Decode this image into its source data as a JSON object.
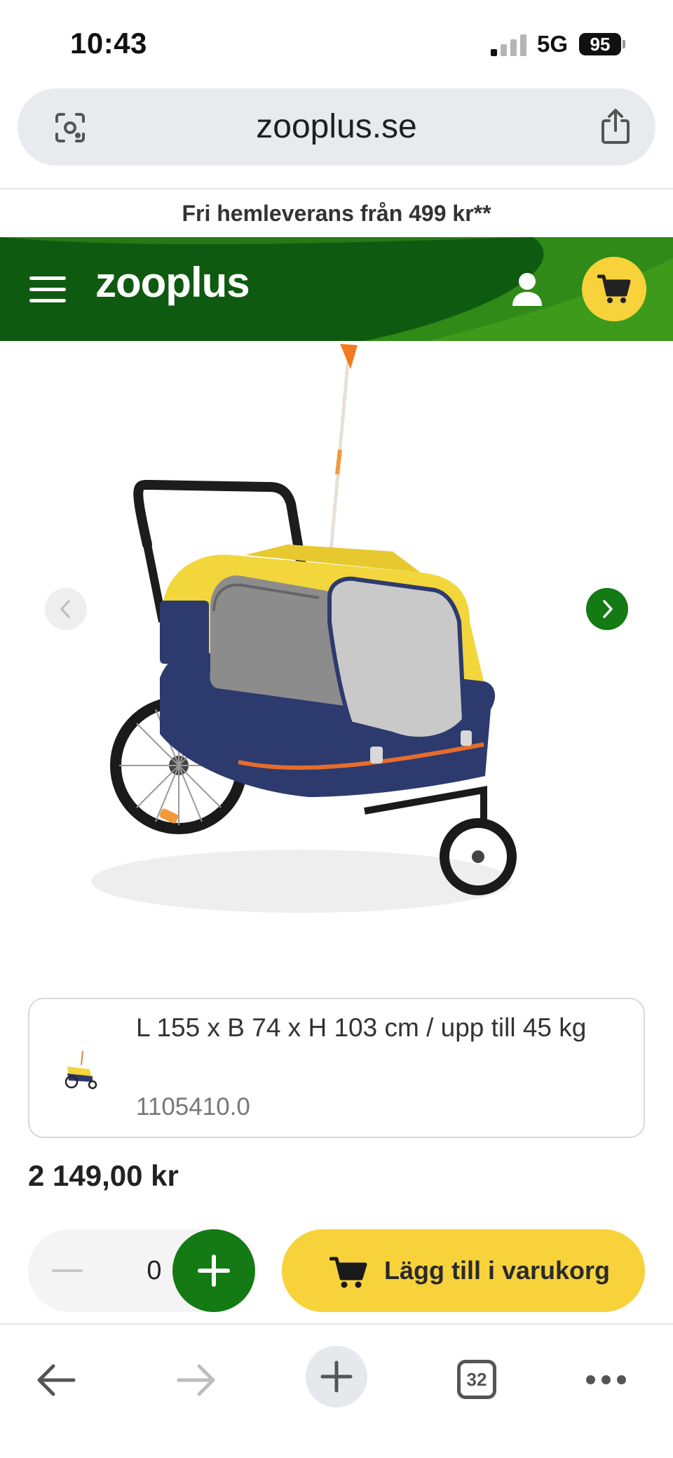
{
  "status_bar": {
    "time": "10:43",
    "network": "5G",
    "battery": "95"
  },
  "browser": {
    "url": "zooplus.se",
    "tab_count": "32"
  },
  "promo": {
    "text": "Fri hemleverans från 499 kr**"
  },
  "header": {
    "logo": "zooplus",
    "brand_color": "#0e5a10",
    "accent_color": "#f7d23b"
  },
  "product": {
    "image_alt": "Bike trailer / dog stroller, yellow and navy",
    "variant": {
      "description": "L 155 x B 74 x H 103 cm / upp till 45 kg",
      "code": "1105410.0"
    },
    "price": "2 149,00 kr",
    "quantity": "0",
    "add_to_cart_label": "Lägg till i varukorg"
  },
  "icons": {
    "lens": "lens-icon",
    "share": "share-icon",
    "menu": "menu-icon",
    "user": "user-icon",
    "cart": "cart-icon"
  }
}
